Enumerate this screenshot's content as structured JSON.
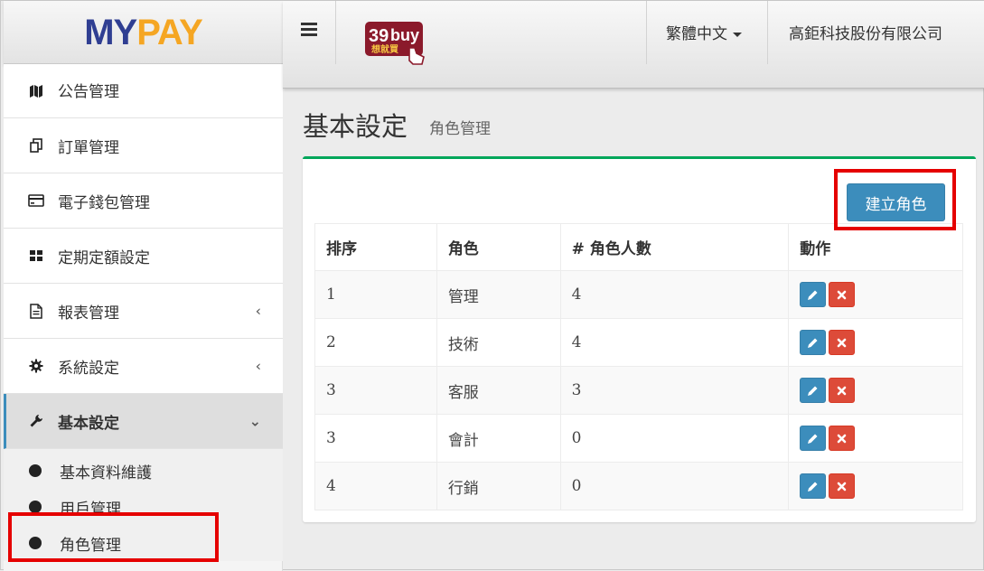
{
  "logo": {
    "part1": "MY",
    "part2": "PAY"
  },
  "sidebar": {
    "items": [
      {
        "label": "公告管理",
        "icon": "map-icon"
      },
      {
        "label": "訂單管理",
        "icon": "copy-icon"
      },
      {
        "label": "電子錢包管理",
        "icon": "credit-card-icon"
      },
      {
        "label": "定期定額設定",
        "icon": "grid-icon"
      },
      {
        "label": "報表管理",
        "icon": "file-icon",
        "chevron": "‹"
      },
      {
        "label": "系統設定",
        "icon": "gear-icon",
        "chevron": "‹"
      },
      {
        "label": "基本設定",
        "icon": "wrench-icon",
        "chevron": "⌄"
      }
    ],
    "submenu": [
      {
        "label": "基本資料維護"
      },
      {
        "label": "用戶管理"
      },
      {
        "label": "角色管理"
      }
    ]
  },
  "header": {
    "brand": {
      "num": "39",
      "word": "buy",
      "sub": "想就買"
    },
    "language": "繁體中文",
    "company": "高鉅科技股份有限公司"
  },
  "page": {
    "title": "基本設定",
    "subtitle": "角色管理"
  },
  "toolbar": {
    "create_label": "建立角色"
  },
  "table": {
    "headers": [
      "排序",
      "角色",
      "# 角色人數",
      "動作"
    ],
    "rows": [
      {
        "order": "1",
        "role": "管理",
        "count": "4"
      },
      {
        "order": "2",
        "role": "技術",
        "count": "4"
      },
      {
        "order": "3",
        "role": "客服",
        "count": "3"
      },
      {
        "order": "3",
        "role": "會計",
        "count": "0"
      },
      {
        "order": "4",
        "role": "行銷",
        "count": "0"
      }
    ]
  },
  "colors": {
    "accent": "#3c8dbc",
    "danger": "#dd4b39",
    "box_top": "#00a65a",
    "highlight": "#e50000"
  }
}
